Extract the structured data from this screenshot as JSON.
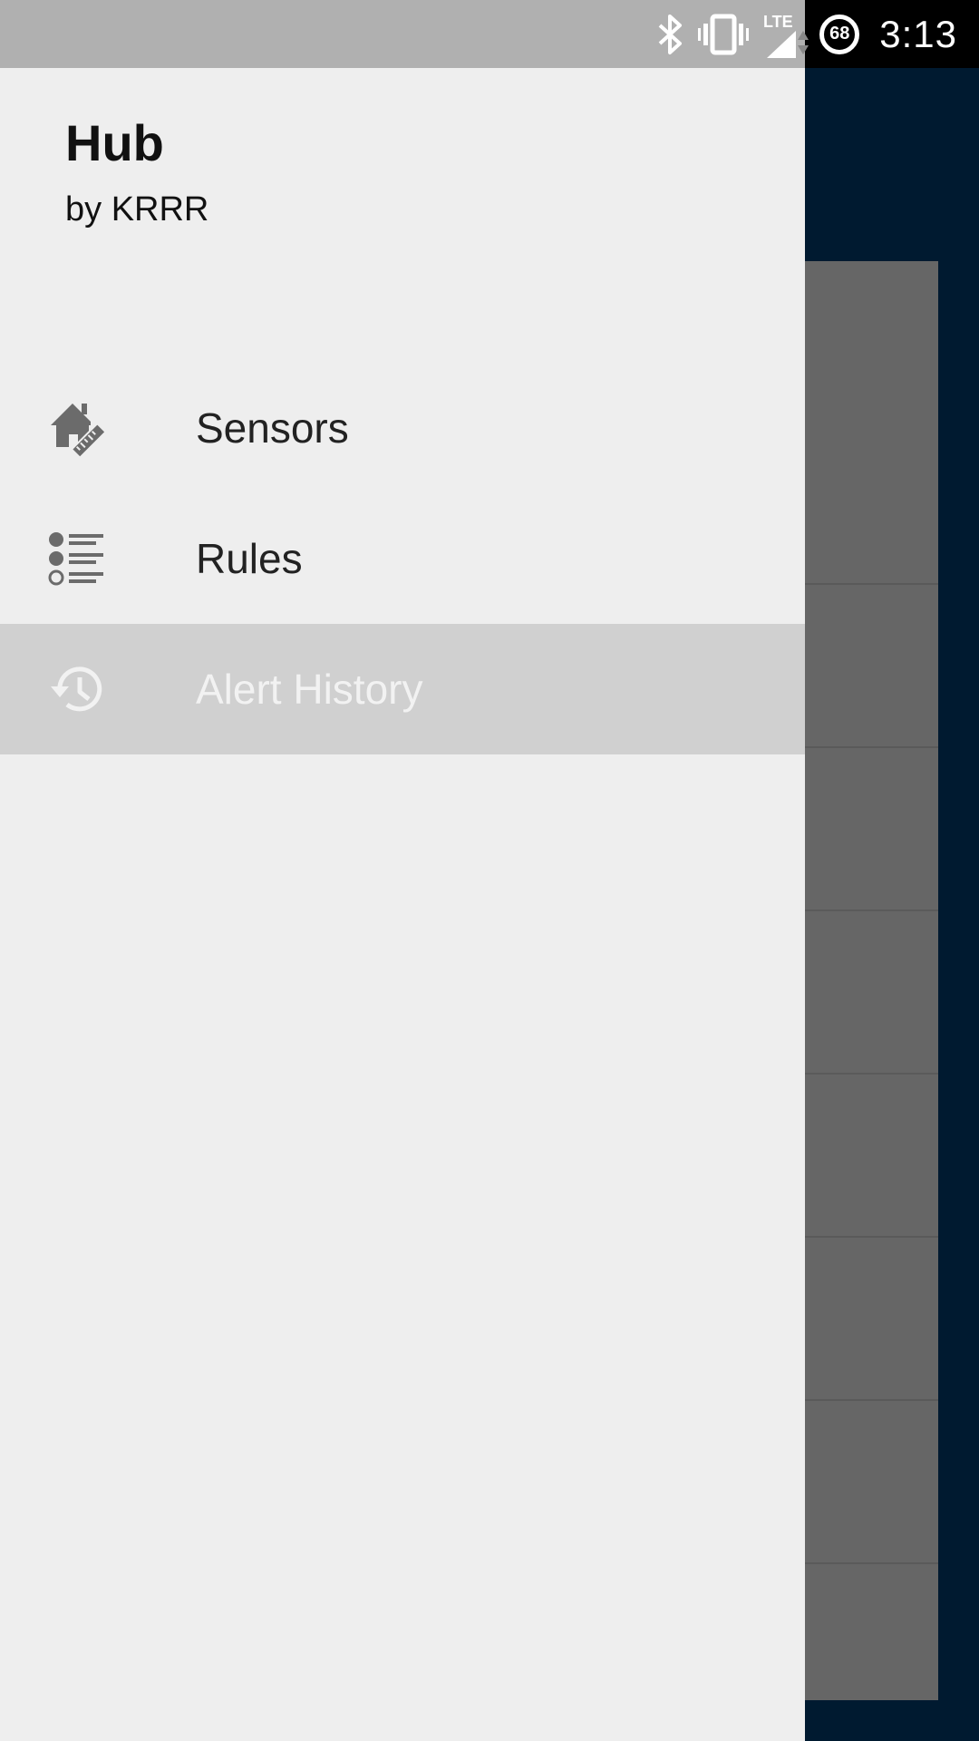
{
  "status_bar": {
    "battery_level": "68",
    "time": "3:13",
    "network_label": "LTE",
    "icons": [
      "bluetooth-icon",
      "vibrate-icon",
      "lte-signal-icon",
      "battery-icon"
    ]
  },
  "drawer": {
    "title": "Hub",
    "subtitle": "by KRRR",
    "items": [
      {
        "label": "Sensors",
        "icon": "home-ruler-icon",
        "selected": false
      },
      {
        "label": "Rules",
        "icon": "list-icon",
        "selected": false
      },
      {
        "label": "Alert History",
        "icon": "history-icon",
        "selected": true
      }
    ]
  },
  "colors": {
    "drawer_bg": "#eeeeee",
    "selected_item_bg": "#d0d0d0",
    "app_bg": "#001a30",
    "status_bar_scrim": "#b0b0b0",
    "icon_gray": "#6b6b6b"
  }
}
